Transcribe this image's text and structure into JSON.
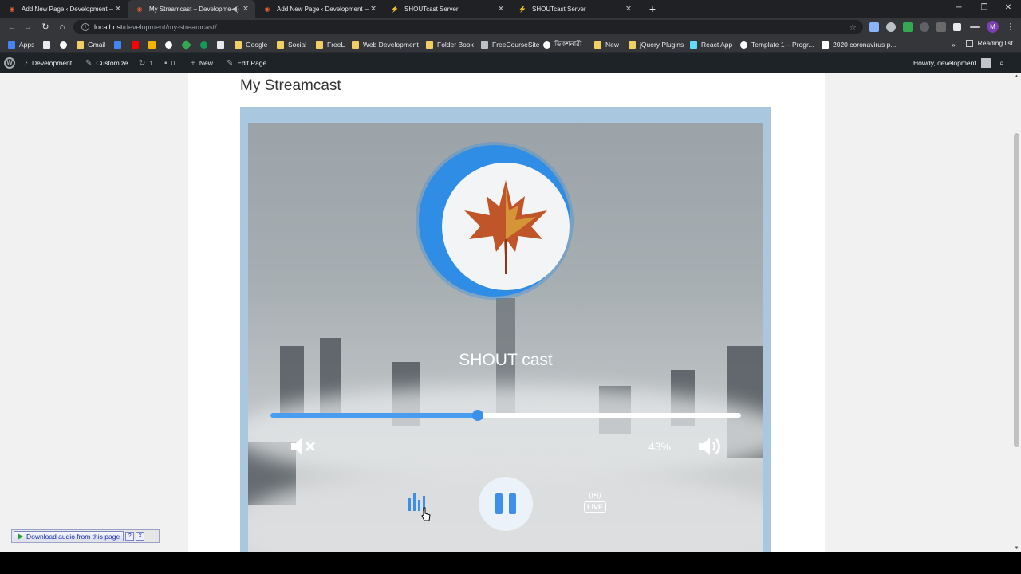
{
  "browser": {
    "tabs": [
      {
        "title": "Add New Page ‹ Development —",
        "active": false
      },
      {
        "title": "My Streamcast – Developme",
        "active": true
      },
      {
        "title": "Add New Page ‹ Development —",
        "active": false
      },
      {
        "title": "SHOUTcast Server",
        "active": false
      },
      {
        "title": "SHOUTcast Server",
        "active": false
      }
    ],
    "url_host": "localhost",
    "url_path": "/development/my-streamcast/",
    "profile_initial": "M",
    "bookmarks": [
      "Apps",
      "Gmail",
      "Google",
      "Social",
      "FreeL",
      "Web Development",
      "Folder Book",
      "FreeCourseSite",
      "ডিকশনারী",
      "New",
      "jQuery Plugins",
      "React App",
      "Template 1 – Progr...",
      "2020 coronavirus p..."
    ],
    "reading_list": "Reading list",
    "more": "»"
  },
  "wpadmin": {
    "site": "Development",
    "customize": "Customize",
    "updates": "1",
    "comments": "0",
    "new": "New",
    "edit_page": "Edit Page",
    "greeting": "Howdy, development"
  },
  "page": {
    "title": "My Streamcast"
  },
  "player": {
    "station_name": "SHOUT cast",
    "progress_fraction": 0.44,
    "volume_label": "43%",
    "state": "playing",
    "live_label": "LIVE",
    "colors": {
      "accent": "#3a91ec",
      "ring": "#2f8de6"
    }
  },
  "download_bar": {
    "label": "Download audio from this page",
    "help": "?",
    "close": "X"
  },
  "icons": [
    "back-arrow-icon",
    "forward-arrow-icon",
    "reload-icon",
    "home-icon",
    "info-icon",
    "star-icon",
    "extensions-icon",
    "mute-icon",
    "volume-icon",
    "equalizer-icon",
    "pause-icon",
    "live-broadcast-icon",
    "wordpress-logo-icon",
    "search-icon"
  ]
}
